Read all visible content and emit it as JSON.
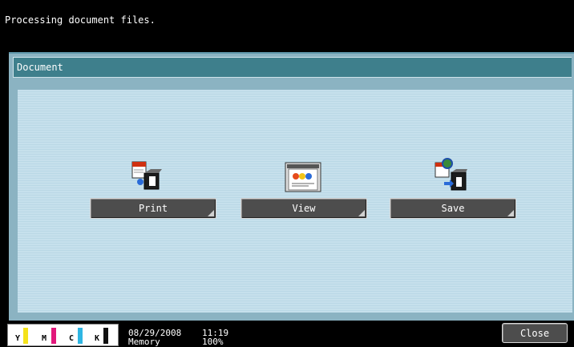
{
  "status_bar": {
    "message": "Processing document files."
  },
  "panel": {
    "title": "Document"
  },
  "functions": [
    {
      "label": "Print",
      "icon": "print-icon"
    },
    {
      "label": "View",
      "icon": "view-icon"
    },
    {
      "label": "Save",
      "icon": "save-icon"
    }
  ],
  "footer": {
    "toner": [
      {
        "label": "Y",
        "color": "#f4e21a"
      },
      {
        "label": "M",
        "color": "#e2187b"
      },
      {
        "label": "C",
        "color": "#2fb6e3"
      },
      {
        "label": "K",
        "color": "#111111"
      }
    ],
    "date": "08/29/2008",
    "memory_label": "Memory",
    "time": "11:19",
    "memory_value": "100%",
    "close_label": "Close"
  }
}
